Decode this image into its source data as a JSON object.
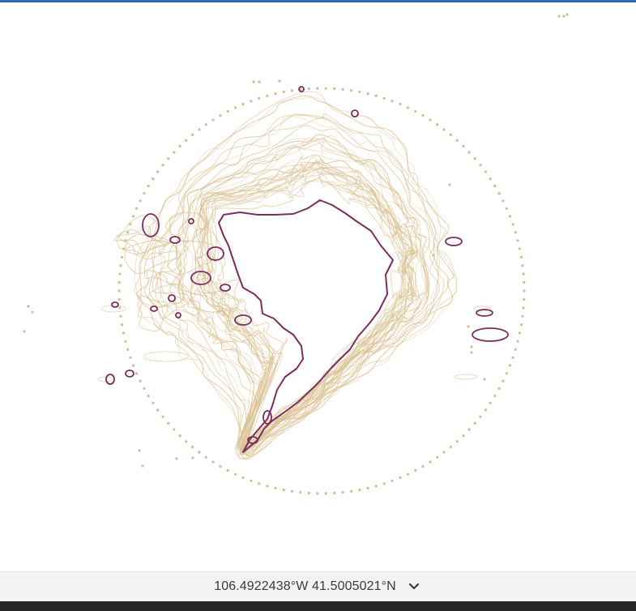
{
  "theme": {
    "accent": "#2b6cb8",
    "contour_color": "#d9bf8f",
    "extent_color": "#7a2e5c",
    "circle_color": "#d2bb92",
    "status_bg": "#f3f3f3",
    "bottom_bg": "#262626"
  },
  "map": {
    "projection": "polar-stereographic-north",
    "layers": [
      {
        "name": "historical-extent-contours",
        "style": "many thin tan lines"
      },
      {
        "name": "current-sea-ice-extent",
        "style": "dark magenta outline"
      },
      {
        "name": "latitude-circle",
        "style": "dotted tan circle"
      }
    ]
  },
  "status_bar": {
    "coordinates": "106.4922438°W 41.5005021°N",
    "expand_icon": "chevron-down-icon"
  }
}
